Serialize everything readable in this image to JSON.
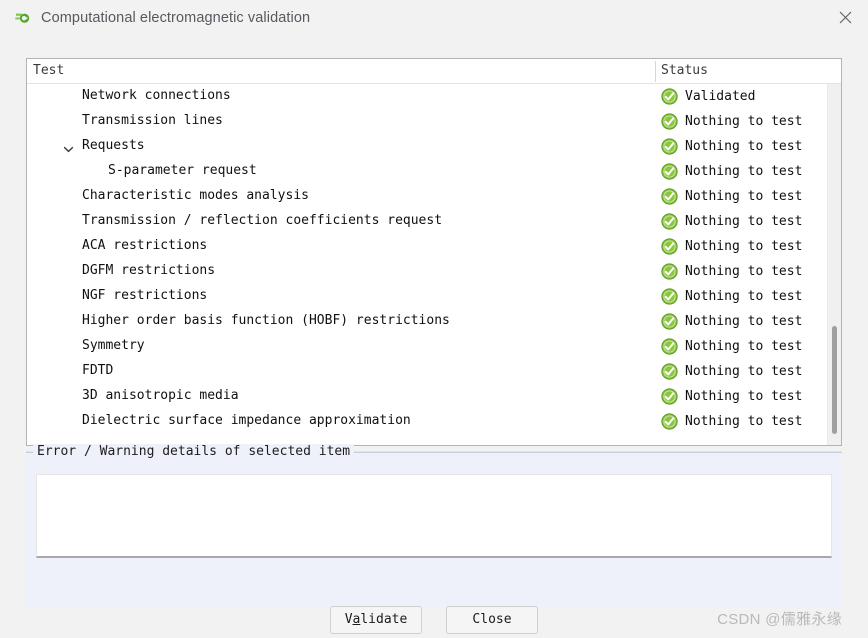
{
  "window": {
    "title": "Computational electromagnetic validation",
    "app_icon": "feko-logo-icon",
    "close_icon": "close-icon"
  },
  "tree": {
    "columns": [
      "Test",
      "Status"
    ],
    "rows": [
      {
        "label": "Network connections",
        "indent": 1,
        "expander": "none",
        "status": "Validated",
        "status_icon": "check-circle-green-icon"
      },
      {
        "label": "Transmission lines",
        "indent": 1,
        "expander": "none",
        "status": "Nothing to test",
        "status_icon": "check-circle-green-icon"
      },
      {
        "label": "Requests",
        "indent": 1,
        "expander": "chevron-down",
        "status": "Nothing to test",
        "status_icon": "check-circle-green-icon"
      },
      {
        "label": "S-parameter request",
        "indent": 2,
        "expander": "none",
        "status": "Nothing to test",
        "status_icon": "check-circle-green-icon"
      },
      {
        "label": "Characteristic modes analysis",
        "indent": 1,
        "expander": "none",
        "status": "Nothing to test",
        "status_icon": "check-circle-green-icon"
      },
      {
        "label": "Transmission / reflection coefficients request",
        "indent": 1,
        "expander": "none",
        "status": "Nothing to test",
        "status_icon": "check-circle-green-icon"
      },
      {
        "label": "ACA restrictions",
        "indent": 1,
        "expander": "none",
        "status": "Nothing to test",
        "status_icon": "check-circle-green-icon"
      },
      {
        "label": "DGFM restrictions",
        "indent": 1,
        "expander": "none",
        "status": "Nothing to test",
        "status_icon": "check-circle-green-icon"
      },
      {
        "label": "NGF restrictions",
        "indent": 1,
        "expander": "none",
        "status": "Nothing to test",
        "status_icon": "check-circle-green-icon"
      },
      {
        "label": "Higher order basis function (HOBF) restrictions",
        "indent": 1,
        "expander": "none",
        "status": "Nothing to test",
        "status_icon": "check-circle-green-icon"
      },
      {
        "label": "Symmetry",
        "indent": 1,
        "expander": "none",
        "status": "Nothing to test",
        "status_icon": "check-circle-green-icon"
      },
      {
        "label": "FDTD",
        "indent": 1,
        "expander": "none",
        "status": "Nothing to test",
        "status_icon": "check-circle-green-icon"
      },
      {
        "label": "3D anisotropic media",
        "indent": 1,
        "expander": "none",
        "status": "Nothing to test",
        "status_icon": "check-circle-green-icon"
      },
      {
        "label": "Dielectric surface impedance approximation",
        "indent": 1,
        "expander": "none",
        "status": "Nothing to test",
        "status_icon": "check-circle-green-icon"
      }
    ],
    "scrollbar": {
      "orientation": "vertical",
      "thumb_top_pct": 67,
      "thumb_height_pct": 30
    }
  },
  "details": {
    "legend": "Error / Warning details of selected item",
    "text_value": "",
    "placeholder": ""
  },
  "buttons": [
    {
      "name": "validate-button",
      "label_before": "V",
      "accel": "a",
      "label_after": "lidate"
    },
    {
      "name": "close-button",
      "label_before": "Close",
      "accel": "",
      "label_after": ""
    }
  ],
  "watermark": "CSDN @儒雅永缘",
  "colors": {
    "status_green": "#6cb33f",
    "window_bg": "#f2f2f2",
    "panel_bg": "#eef1fa",
    "field_bg": "#ffffff",
    "title_text": "#555a5f"
  }
}
